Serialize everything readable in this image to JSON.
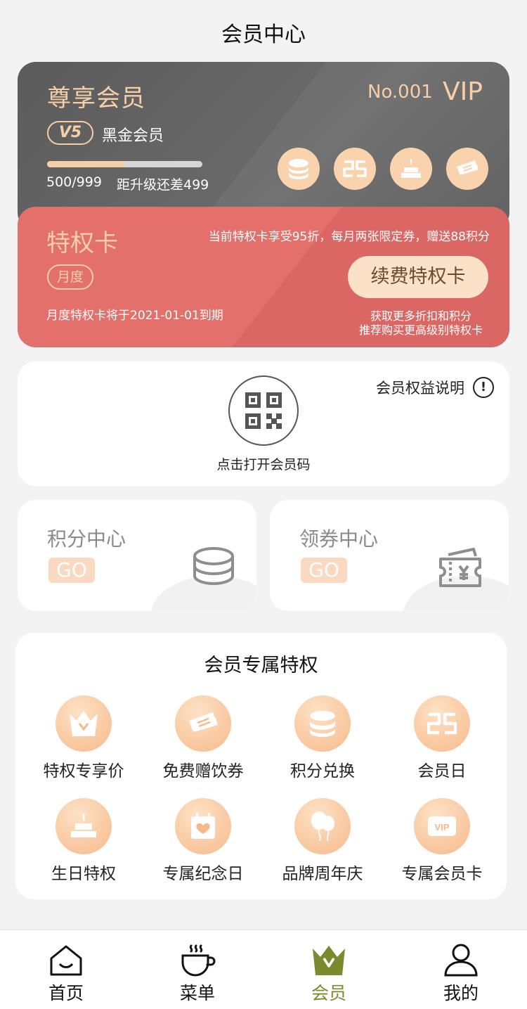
{
  "header": {
    "title": "会员中心"
  },
  "member_card": {
    "title": "尊享会员",
    "number": "No.001",
    "vip": "VIP",
    "level_badge": "V5",
    "level_name": "黑金会员",
    "progress_fraction": 0.5,
    "points_text": "500/999",
    "upgrade_text": "距升级还差499",
    "icons": [
      "coins-icon",
      "calendar-25-icon",
      "birthday-cake-icon",
      "ticket-icon"
    ],
    "accent_color": "#f6cfa9"
  },
  "privilege_card": {
    "title": "特权卡",
    "description": "当前特权卡享受95折，每月两张限定券，赠送88积分",
    "period_badge": "月度",
    "expire_text": "月度特权卡将于2021-01-01到期",
    "renew_button": "续费特权卡",
    "hint_line1": "获取更多折扣和积分",
    "hint_line2": "推荐购买更高级别特权卡",
    "bg_color": "#e4706c"
  },
  "qr_panel": {
    "benefit_link": "会员权益说明",
    "qr_label": "点击打开会员码"
  },
  "tiles": [
    {
      "title": "积分中心",
      "go": "GO",
      "icon": "coins-icon"
    },
    {
      "title": "领券中心",
      "go": "GO",
      "icon": "coupon-icon"
    }
  ],
  "exclusive": {
    "title": "会员专属特权",
    "items": [
      {
        "label": "特权专享价",
        "icon": "crown-icon"
      },
      {
        "label": "免费赠饮券",
        "icon": "ticket-icon"
      },
      {
        "label": "积分兑换",
        "icon": "coins-icon"
      },
      {
        "label": "会员日",
        "icon": "calendar-25-icon"
      },
      {
        "label": "生日特权",
        "icon": "birthday-cake-icon"
      },
      {
        "label": "专属纪念日",
        "icon": "calendar-heart-icon"
      },
      {
        "label": "品牌周年庆",
        "icon": "balloons-icon"
      },
      {
        "label": "专属会员卡",
        "icon": "vip-card-icon"
      }
    ]
  },
  "tabbar": {
    "tabs": [
      {
        "label": "首页",
        "icon": "home-icon",
        "active": false
      },
      {
        "label": "菜单",
        "icon": "coffee-cup-icon",
        "active": false
      },
      {
        "label": "会员",
        "icon": "crown-icon",
        "active": true
      },
      {
        "label": "我的",
        "icon": "user-icon",
        "active": false
      }
    ],
    "active_color": "#7b8a2e"
  }
}
